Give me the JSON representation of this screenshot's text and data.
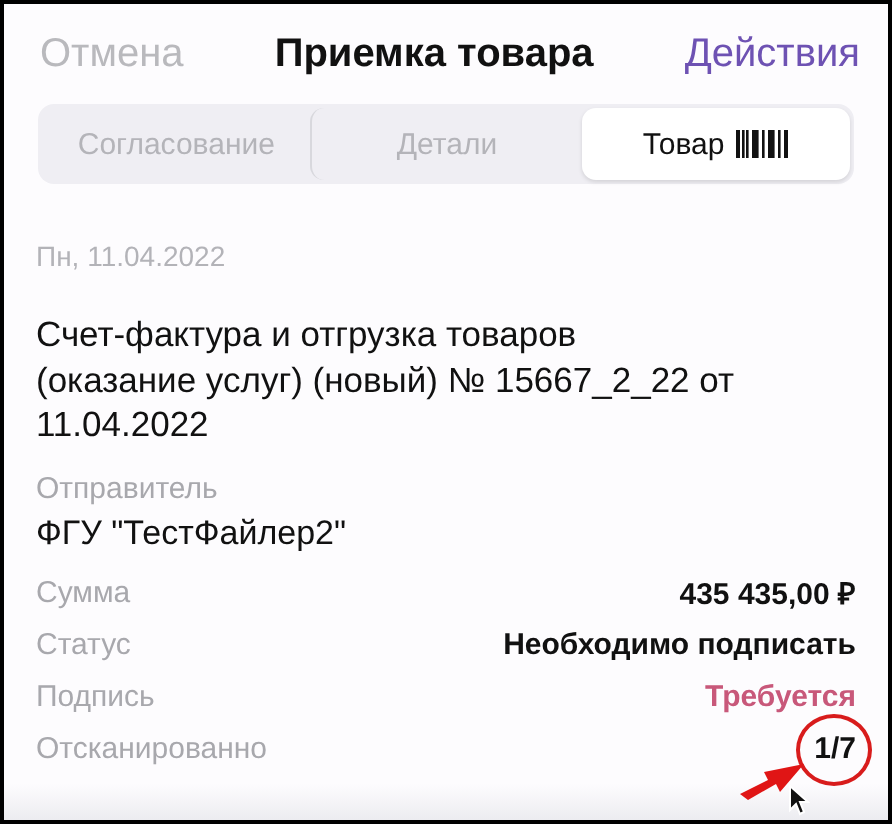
{
  "header": {
    "cancel": "Отмена",
    "title": "Приемка товара",
    "actions": "Действия"
  },
  "tabs": [
    {
      "label": "Согласование",
      "selected": false
    },
    {
      "label": "Детали",
      "selected": false
    },
    {
      "label": "Товар",
      "selected": true,
      "barcode": true
    }
  ],
  "date": "Пн, 11.04.2022",
  "document_title": "Счет-фактура и отгрузка товаров (оказание услуг) (новый) № 15667_2_22 от 11.04.2022",
  "sender": {
    "label": "Отправитель",
    "value": "ФГУ \"ТестФайлер2\""
  },
  "fields": [
    {
      "label": "Сумма",
      "value": "435 435,00 ₽",
      "kind": "normal"
    },
    {
      "label": "Статус",
      "value": "Необходимо подписать",
      "kind": "normal"
    },
    {
      "label": "Подпись",
      "value": "Требуется",
      "kind": "warning"
    },
    {
      "label": "Отсканированно",
      "value": "1/7",
      "kind": "highlighted"
    }
  ]
}
